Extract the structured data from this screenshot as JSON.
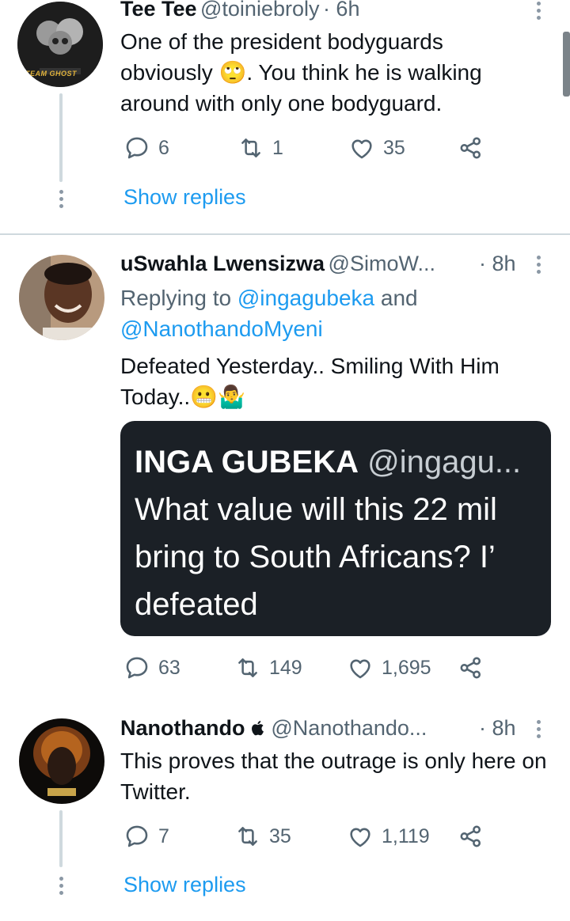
{
  "tweets": [
    {
      "name": "Tee Tee",
      "handle": "@toiniebroly",
      "time": "· 6h",
      "text": "One of the president bodyguards obviously 🙄. You think he is walking around with only one bodyguard.",
      "replies": "6",
      "retweets": "1",
      "likes": "35",
      "show_replies": "Show replies",
      "avatar_label": "TEAM GHOST"
    },
    {
      "name": "uSwahla Lwensizwa",
      "handle": "@SimoW...",
      "time": "· 8h",
      "replying_prefix": "Replying to",
      "replying_to_1": "@ingagubeka",
      "replying_and": "and",
      "replying_to_2": "@NanothandoMyeni",
      "text": "Defeated Yesterday.. Smiling With Him Today..😬🤷‍♂️",
      "quote": {
        "name": "INGA GUBEKA",
        "handle": "@ingagu...",
        "text": "What value will this 22 mil bring to South Africans? I’ defeated"
      },
      "replies": "63",
      "retweets": "149",
      "likes": "1,695"
    },
    {
      "name": "Nanothando",
      "handle": "@Nanothando...",
      "time": "· 8h",
      "text": "This proves that the outrage is only  here on Twitter.",
      "replies": "7",
      "retweets": "35",
      "likes": "1,119",
      "show_replies": "Show replies"
    }
  ],
  "colors": {
    "accent": "#1d9bf0",
    "text": "#0f1419",
    "muted": "#536471",
    "quote_bg": "#1b2026"
  }
}
